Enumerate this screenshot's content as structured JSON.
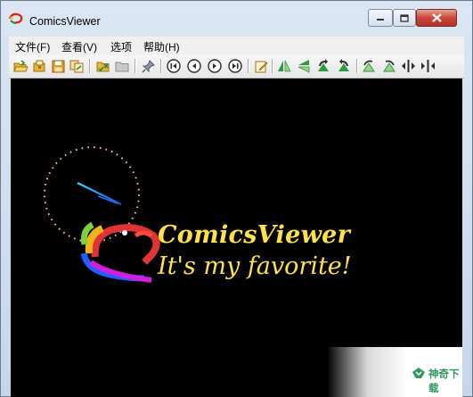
{
  "window": {
    "title": "ComicsViewer",
    "caption_buttons": {
      "minimize": "minimize-icon",
      "maximize": "maximize-icon",
      "close": "close-icon"
    }
  },
  "menu": [
    "文件(F)",
    "查看(V)",
    "选项",
    "帮助(H)"
  ],
  "toolbar": {
    "buttons": [
      "open-folder-icon",
      "open-archive-icon",
      "save-icon",
      "copy-icon",
      "favorites-icon",
      "folder-icon",
      "pin-icon",
      "first-page-icon",
      "previous-page-icon",
      "next-page-icon",
      "last-page-icon",
      "edit-icon",
      "flip-horizontal-icon",
      "flip-vertical-icon",
      "rotate-left-icon",
      "rotate-right-icon",
      "zoom-in-icon",
      "zoom-out-icon",
      "fit-width-icon",
      "fit-height-icon"
    ]
  },
  "splash": {
    "title": "ComicsViewer",
    "tagline": "It's my favorite!",
    "background": "#000000",
    "text_color": "#ffe24a"
  },
  "watermark": {
    "text": "神奇下载"
  }
}
